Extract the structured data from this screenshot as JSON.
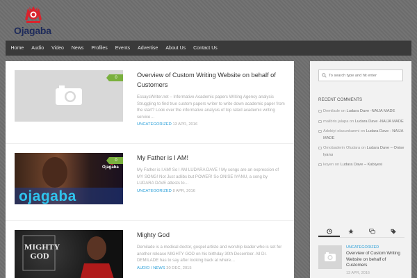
{
  "site": {
    "logo_text": "Ojagaba",
    "brand_red": "#d9232d",
    "brand_navy": "#1d2a5a"
  },
  "nav": {
    "items": [
      {
        "label": "Home"
      },
      {
        "label": "Audio"
      },
      {
        "label": "Video"
      },
      {
        "label": "News"
      },
      {
        "label": "Profiles"
      },
      {
        "label": "Events"
      },
      {
        "label": "Advertise"
      },
      {
        "label": "About Us"
      },
      {
        "label": "Contact Us"
      }
    ]
  },
  "posts": [
    {
      "title": "Overview of Custom Writing Website on behalf of Customers",
      "excerpt": "EssaysWriter.net – Informative Academic papers Writing Agency analysis Struggling to find true custom papers writer to write down academic paper from the start? Look over the informative analysis of top rated academic writing service…",
      "category": "UNCATEGORIZED",
      "date": "13 APR, 2016",
      "comments": "0"
    },
    {
      "title": "My Father is I AM!",
      "excerpt": "My Father is I AM! So I AM LUDARA DAVE ! My songs are an expression of MY SONG! Not Just adlibs but POWER! So ONISE IYANU, a song by LUDARA DAVE attests to…",
      "category": "UNCATEGORIZED",
      "date": "8 APR, 2016",
      "comments": "0",
      "thumb_overlay": "ojagaba"
    },
    {
      "title": "Mighty God",
      "excerpt": "Demilade is a medical doctor, gospel artiste and worship leader who is set for another release MIGHTY GOD on his birthday 30th December. All Dr. DEMILADE has to say after looking back at where…",
      "category": "AUDIO / NEWS",
      "date": "30 DEC, 2015",
      "comments": "",
      "thumb_overlay": "MIGHTY GOD"
    }
  ],
  "sidebar": {
    "search_placeholder": "To search type and hit enter",
    "recent_comments_title": "RECENT COMMENTS",
    "recent_comments": [
      {
        "author": "Demilade",
        "on": "on",
        "post": "Ludara Dave -NAIJA MADE"
      },
      {
        "author": "malibris jalapa",
        "on": "on",
        "post": "Ludara Dave -NAIJA MADE"
      },
      {
        "author": "Adebiyi olasunkanmi",
        "on": "on",
        "post": "Ludara Dave - NAIJA MADE"
      },
      {
        "author": "Omobaderin Oludara",
        "on": "on",
        "post": "Ludara Dave – Onise Iyanu"
      },
      {
        "author": "koyen",
        "on": "on",
        "post": "Ludara Dave – Kabiyesi"
      }
    ],
    "tab_post": {
      "category": "UNCATEGORIZED",
      "title": "Overview of Custom Writing Website on behalf of Customers",
      "date": "13 APR, 2016"
    }
  }
}
